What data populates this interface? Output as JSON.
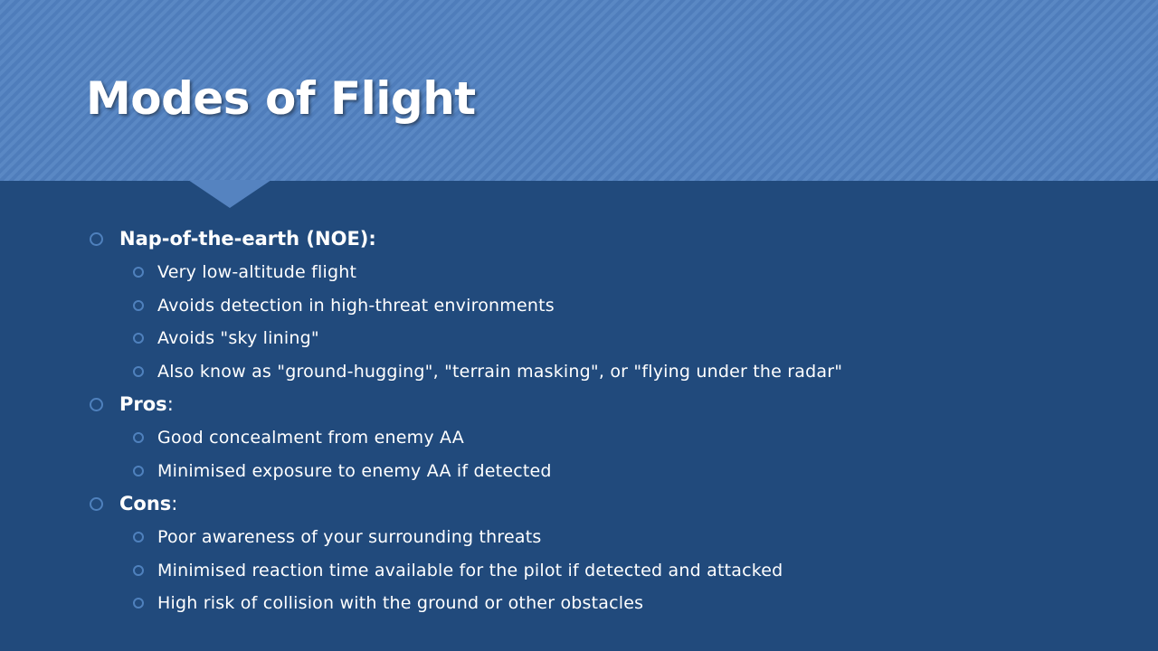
{
  "slide": {
    "title": "Modes of Flight",
    "sections": [
      {
        "heading": "Nap-of-the-earth (NOE):",
        "suffix": "",
        "items": [
          "Very low-altitude flight",
          "Avoids detection in high-threat environments",
          "Avoids \"sky lining\"",
          "Also know as \"ground-hugging\",  \"terrain masking\", or \"flying under the radar\""
        ]
      },
      {
        "heading": "Pros",
        "suffix": ":",
        "items": [
          "Good concealment from enemy AA",
          "Minimised exposure to enemy AA if detected"
        ]
      },
      {
        "heading": "Cons",
        "suffix": ":",
        "items": [
          "Poor awareness of your surrounding threats",
          "Minimised reaction time available for the pilot if detected and attacked",
          "High risk of collision with the ground or other obstacles"
        ]
      }
    ]
  },
  "colors": {
    "background": "#214a7c",
    "header_band": "#5583c0",
    "bullet": "#4f81bd",
    "text": "#ffffff"
  },
  "icons": {
    "bullet": "hollow-circle-icon"
  }
}
